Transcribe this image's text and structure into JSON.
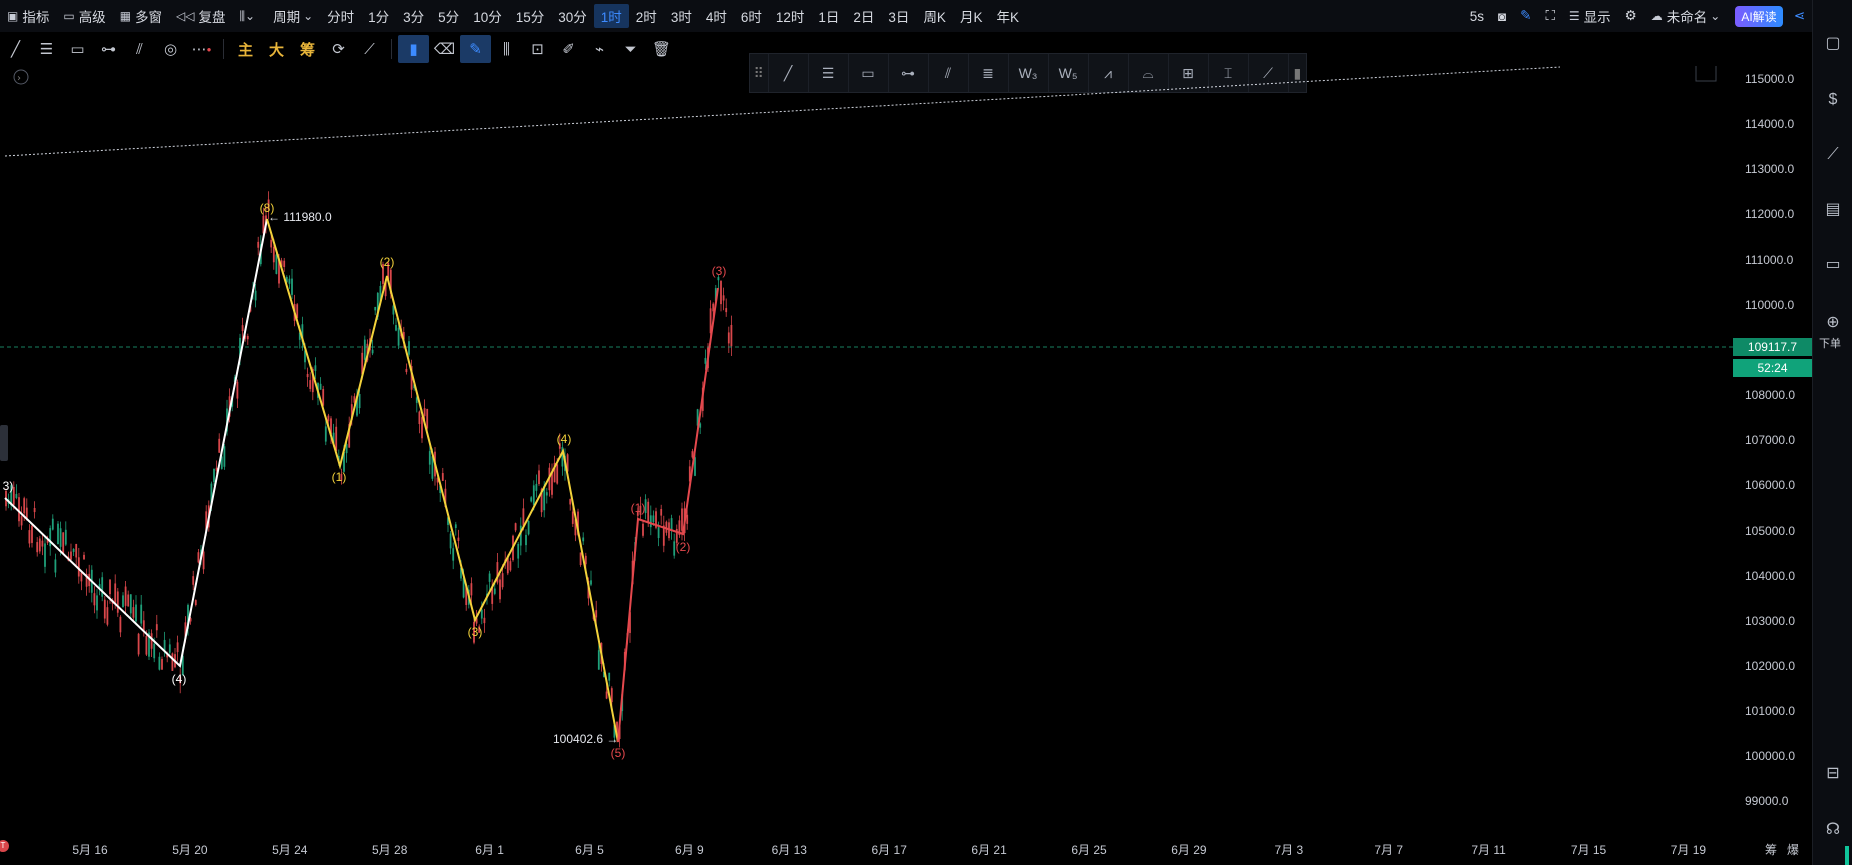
{
  "topbar": {
    "items": [
      {
        "label": "指标",
        "icon": "indicator-icon"
      },
      {
        "label": "高级",
        "icon": "advanced-icon"
      },
      {
        "label": "多窗",
        "icon": "multi-window-icon"
      },
      {
        "label": "复盘",
        "icon": "replay-icon"
      },
      {
        "label": "",
        "icon": "chart-type-icon"
      },
      {
        "label": "周期",
        "icon": ""
      }
    ],
    "intervals": [
      "分时",
      "1分",
      "3分",
      "5分",
      "10分",
      "15分",
      "30分",
      "1时",
      "2时",
      "3时",
      "4时",
      "6时",
      "12时",
      "1日",
      "2日",
      "3日",
      "周K",
      "月K",
      "年K"
    ],
    "active_interval": "1时",
    "right": {
      "refresh": "5s",
      "display": "显示",
      "unnamed": "未命名",
      "ai": "AI解读"
    }
  },
  "toolbar2": {
    "main_label": "主",
    "big_label": "大",
    "chip_label": "筹"
  },
  "sidebar": {
    "order_label": "下单"
  },
  "price_axis": {
    "ticks": [
      "115000.0",
      "114000.0",
      "113000.0",
      "112000.0",
      "111000.0",
      "110000.0",
      "108000.0",
      "107000.0",
      "106000.0",
      "105000.0",
      "104000.0",
      "103000.0",
      "102000.0",
      "101000.0",
      "100000.0",
      "99000.0"
    ],
    "last_price": "109117.7",
    "countdown": "52:24",
    "last_price_color": "#0e8a66",
    "countdown_color": "#10a37a"
  },
  "time_axis": {
    "ticks": [
      "5月 16",
      "5月 20",
      "5月 24",
      "5月 28",
      "6月 1",
      "6月 5",
      "6月 9",
      "6月 13",
      "6月 17",
      "6月 21",
      "6月 25",
      "6月 29",
      "7月 3",
      "7月 7",
      "7月 11",
      "7月 15",
      "7月 19"
    ],
    "right_labels": [
      "筹",
      "爆"
    ]
  },
  "annotations": {
    "high_note": "111980.0",
    "low_note": "100402.6",
    "white_waves": [
      "3)",
      "(4)",
      "(8)"
    ],
    "yellow_waves": [
      "(1)",
      "(2)",
      "(3)",
      "(4)"
    ],
    "red_waves": [
      "(5)",
      "(1)",
      "(2)",
      "(3)"
    ],
    "colors": {
      "white": "#ffffff",
      "yellow": "#f3d23b",
      "red": "#e5484d",
      "up": "#1fa07a",
      "down": "#d9474b"
    }
  }
}
